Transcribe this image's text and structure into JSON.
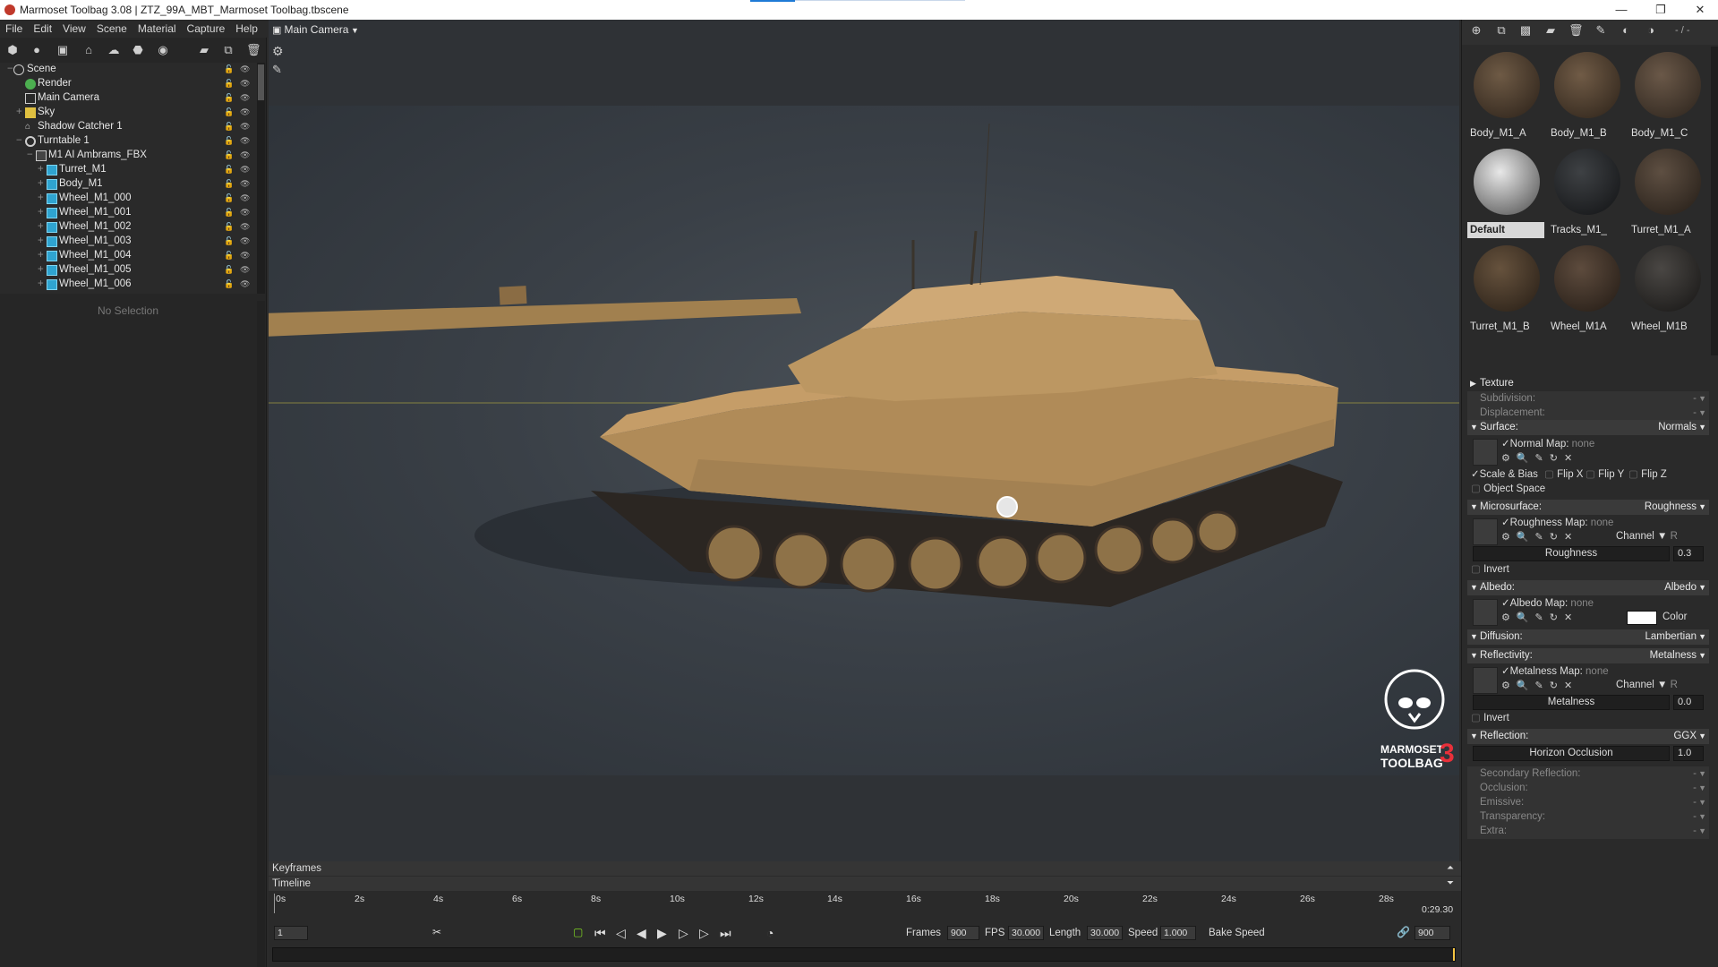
{
  "titlebar": {
    "title": "Marmoset Toolbag 3.08  |  ZTZ_99A_MBT_Marmoset Toolbag.tbscene",
    "minimize": "—",
    "restore": "❐",
    "close": "✕"
  },
  "menu": [
    "File",
    "Edit",
    "View",
    "Scene",
    "Material",
    "Capture",
    "Help"
  ],
  "viewport": {
    "camera_label": "Main Camera",
    "logo_line1": "MARMOSET",
    "logo_line2": "TOOLBAG",
    "logo_version": "3",
    "accent_color": "#e8303a"
  },
  "scene_tree": {
    "items": [
      {
        "label": "Scene",
        "indent": 0,
        "icon": "scene-icon"
      },
      {
        "label": "Render",
        "indent": 1,
        "icon": "render-icon"
      },
      {
        "label": "Main Camera",
        "indent": 1,
        "icon": "camera-icon"
      },
      {
        "label": "Sky",
        "indent": 1,
        "icon": "sky-icon"
      },
      {
        "label": "Shadow Catcher 1",
        "indent": 1,
        "icon": "shadow-catcher-icon"
      },
      {
        "label": "Turntable 1",
        "indent": 1,
        "icon": "turntable-icon"
      },
      {
        "label": "M1 AI Ambrams_FBX",
        "indent": 2,
        "icon": "fbx-icon"
      },
      {
        "label": "Turret_M1",
        "indent": 3,
        "icon": "mesh-icon"
      },
      {
        "label": "Body_M1",
        "indent": 3,
        "icon": "mesh-icon"
      },
      {
        "label": "Wheel_M1_000",
        "indent": 3,
        "icon": "mesh-icon"
      },
      {
        "label": "Wheel_M1_001",
        "indent": 3,
        "icon": "mesh-icon"
      },
      {
        "label": "Wheel_M1_002",
        "indent": 3,
        "icon": "mesh-icon"
      },
      {
        "label": "Wheel_M1_003",
        "indent": 3,
        "icon": "mesh-icon"
      },
      {
        "label": "Wheel_M1_004",
        "indent": 3,
        "icon": "mesh-icon"
      },
      {
        "label": "Wheel_M1_005",
        "indent": 3,
        "icon": "mesh-icon"
      },
      {
        "label": "Wheel_M1_006",
        "indent": 3,
        "icon": "mesh-icon"
      }
    ],
    "no_selection": "No Selection"
  },
  "timeline": {
    "keyframes_label": "Keyframes",
    "timeline_label": "Timeline",
    "ticks": [
      "0s",
      "2s",
      "4s",
      "6s",
      "8s",
      "10s",
      "12s",
      "14s",
      "16s",
      "18s",
      "20s",
      "22s",
      "24s",
      "26s",
      "28s"
    ],
    "end_time": "0:29.30",
    "current_frame": "1",
    "frames_label": "Frames",
    "frames_value": "900",
    "fps_label": "FPS",
    "fps_value": "30.000",
    "length_label": "Length",
    "length_value": "30.000",
    "speed_label": "Speed",
    "speed_value": "1.000",
    "bake_speed": "Bake Speed",
    "end_frame": "900"
  },
  "materials": {
    "page": "- / -",
    "items": [
      {
        "name": "Body_M1_A",
        "color": "#4a3a2c",
        "selected": false
      },
      {
        "name": "Body_M1_B",
        "color": "#4b3b2d",
        "selected": false
      },
      {
        "name": "Body_M1_C",
        "color": "#463a30",
        "selected": false
      },
      {
        "name": "Default",
        "color": "#9a9a9a",
        "selected": true
      },
      {
        "name": "Tracks_M1_",
        "color": "#222426",
        "selected": false
      },
      {
        "name": "Turret_M1_A",
        "color": "#3e342c",
        "selected": false
      },
      {
        "name": "Turret_M1_B",
        "color": "#443629",
        "selected": false
      },
      {
        "name": "Wheel_M1A",
        "color": "#3d3129",
        "selected": false
      },
      {
        "name": "Wheel_M1B",
        "color": "#2b2a29",
        "selected": false
      }
    ]
  },
  "properties": {
    "texture": "Texture",
    "subdivision": "Subdivision:",
    "subdivision_value": "-",
    "displacement": "Displacement:",
    "displacement_value": "-",
    "surface": "Surface:",
    "surface_value": "Normals",
    "normal_map": "Normal Map:",
    "normal_map_value": "none",
    "scale_bias": "Scale & Bias",
    "flip_x": "Flip X",
    "flip_y": "Flip Y",
    "flip_z": "Flip Z",
    "object_space": "Object Space",
    "microsurface": "Microsurface:",
    "microsurface_value": "Roughness",
    "roughness_map": "Roughness Map:",
    "roughness_map_value": "none",
    "channel_label": "Channel",
    "channel_value": "R",
    "roughness": "Roughness",
    "roughness_value": "0.3",
    "invert": "Invert",
    "albedo": "Albedo:",
    "albedo_value": "Albedo",
    "albedo_map": "Albedo Map:",
    "albedo_map_value": "none",
    "color_label": "Color",
    "albedo_color": "#ffffff",
    "diffusion": "Diffusion:",
    "diffusion_value": "Lambertian",
    "reflectivity": "Reflectivity:",
    "reflectivity_value": "Metalness",
    "metalness_map": "Metalness Map:",
    "metalness_map_value": "none",
    "metalness": "Metalness",
    "metalness_value": "0.0",
    "reflection": "Reflection:",
    "reflection_value": "GGX",
    "horizon_occlusion": "Horizon Occlusion",
    "horizon_occlusion_value": "1.0",
    "secondary_reflection": "Secondary Reflection:",
    "occlusion": "Occlusion:",
    "emissive": "Emissive:",
    "transparency": "Transparency:",
    "extra": "Extra:",
    "dash": "-"
  }
}
